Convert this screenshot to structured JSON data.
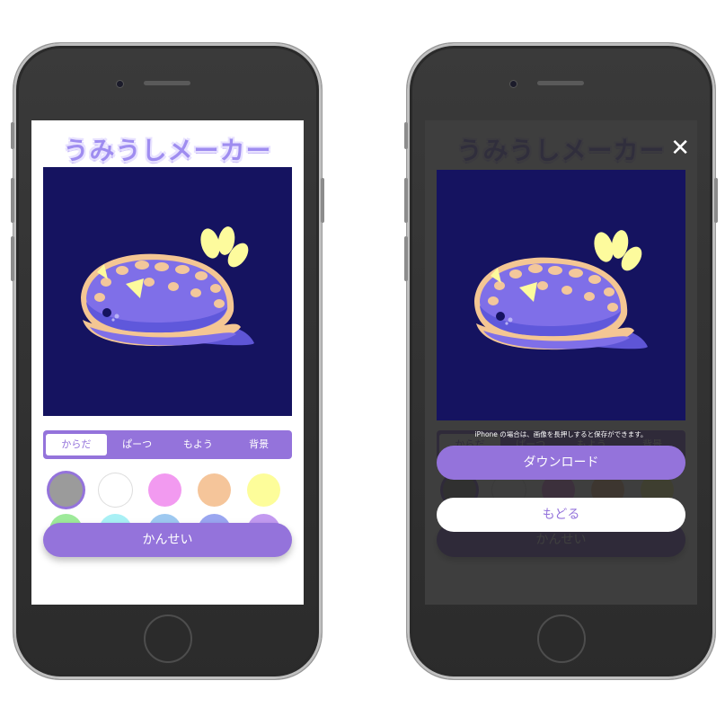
{
  "app": {
    "title": "うみうしメーカー"
  },
  "tabs": [
    {
      "label": "からだ",
      "active": true
    },
    {
      "label": "ぱーつ",
      "active": false
    },
    {
      "label": "もよう",
      "active": false
    },
    {
      "label": "背景",
      "active": false
    }
  ],
  "swatches": [
    "#9b9b9b",
    "#ffffff",
    "#f29af0",
    "#f5c59a",
    "#fdfd9a",
    "#9eea9a",
    "#a9f0f5",
    "#9ec9f0",
    "#9aa6f0",
    "#c39af0"
  ],
  "selected_swatch": 0,
  "buttons": {
    "finish": "かんせい",
    "download": "ダウンロード",
    "back": "もどる",
    "close_glyph": "✕"
  },
  "hint": "iPhone の場合は、画像を長押しすると保存ができます。",
  "colors": {
    "accent": "#9473db",
    "canvas_bg": "#151360",
    "body": "#7f6fe8",
    "rim": "#f4c693",
    "spots": "#f3c79b",
    "gills": "#fdfb9d"
  },
  "icons": {
    "close": "close-icon"
  }
}
